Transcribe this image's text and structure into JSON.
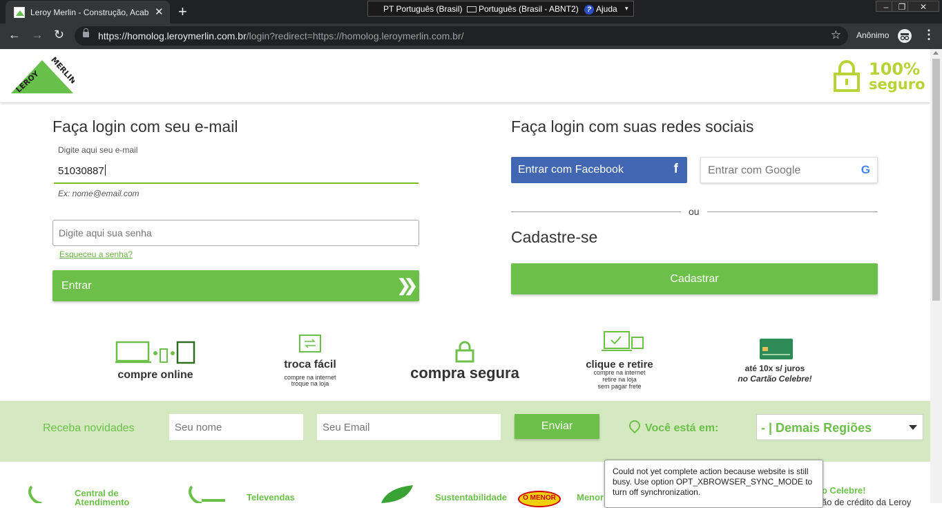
{
  "browser": {
    "tab_title": "Leroy Merlin - Construção, Acaba",
    "tab_close": "✕",
    "new_tab": "+",
    "ime": {
      "lang": "PT Português (Brasil)",
      "keyboard": "Português (Brasil - ABNT2)",
      "help": "Ajuda"
    },
    "url_host": "https://homolog.leroymerlin.com.br",
    "url_path": "/login?redirect=https://homolog.leroymerlin.com.br/",
    "profile": "Anônimo"
  },
  "header": {
    "logo_text": "LEROY MERLIN",
    "secure_line1": "100%",
    "secure_line2": "seguro"
  },
  "email_login": {
    "title": "Faça login com seu e-mail",
    "email_label": "Digite aqui seu e-mail",
    "email_value": "51030887",
    "email_hint": "Ex: nome@email.com",
    "password_placeholder": "Digite aqui sua senha",
    "forgot": "Esqueceu a senha?",
    "submit": "Entrar"
  },
  "social_login": {
    "title": "Faça login com suas redes sociais",
    "facebook": "Entrar com Facebook",
    "google": "Entrar com Google",
    "or": "ou",
    "register_title": "Cadastre-se",
    "register_button": "Cadastrar"
  },
  "benefits": [
    {
      "main": "compre online",
      "sub": []
    },
    {
      "main": "troca fácil",
      "sub": [
        "compre na internet",
        "troque na loja"
      ]
    },
    {
      "main": "compra segura",
      "sub": []
    },
    {
      "main": "clique e retire",
      "sub": [
        "compre na internet",
        "retire na loja",
        "sem pagar frete"
      ]
    },
    {
      "main": "até 10x s/ juros",
      "sub2": "no Cartão Celebre!"
    }
  ],
  "newsletter": {
    "label": "Receba novidades",
    "name_placeholder": "Seu nome",
    "email_placeholder": "Seu Email",
    "send": "Enviar",
    "location_label": "Você está em:",
    "region": "- | Demais Regiões"
  },
  "footer": {
    "central": "Central de Atendimento",
    "televendas": "Televendas",
    "sustentabilidade": "Sustentabilidade",
    "menor_badge": "O MENOR",
    "menor": "Menor",
    "celebre": "o Celebre!",
    "celebre_sub": "ão de crédito da Leroy"
  },
  "tooltip": "Could not yet complete action because website is still busy. Use option OPT_XBROWSER_SYNC_MODE to turn off synchronization.",
  "colors": {
    "brand_green": "#6cc04a",
    "facebook_blue": "#4267b2",
    "secure_lime": "#b6d436"
  }
}
